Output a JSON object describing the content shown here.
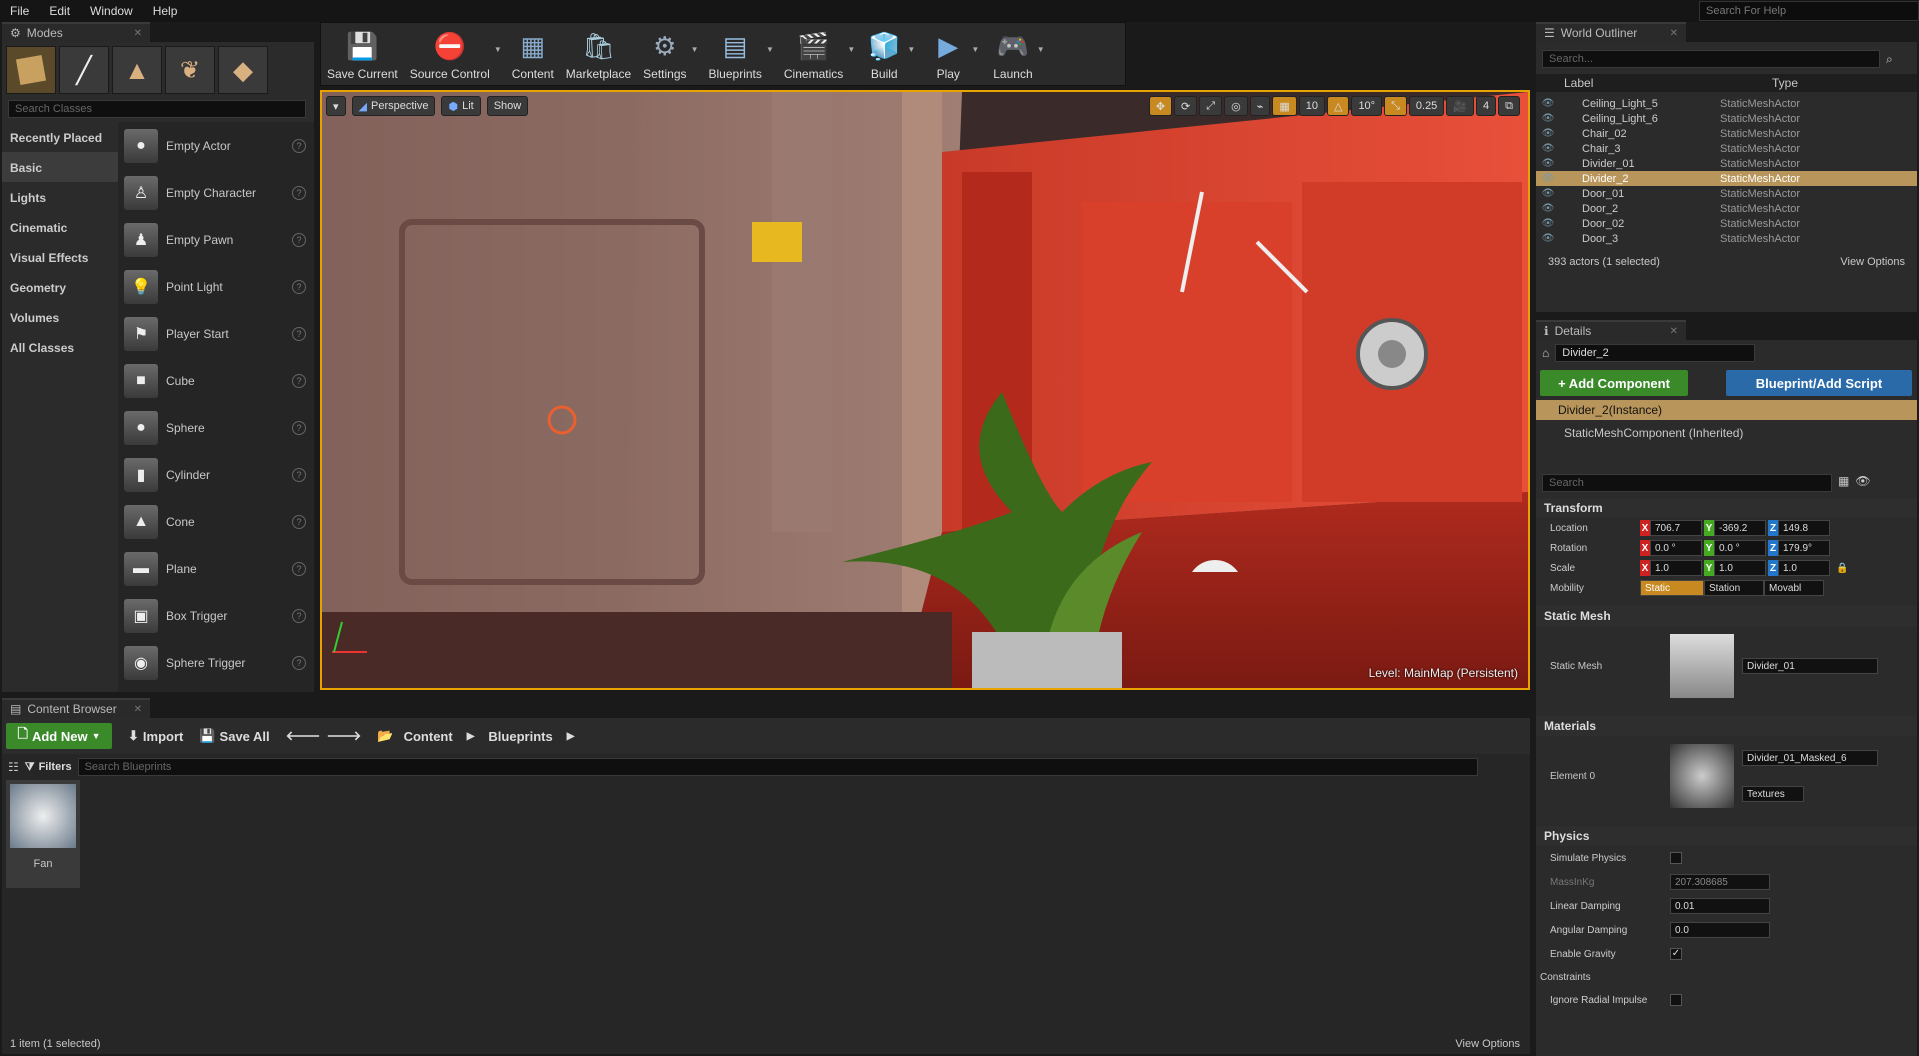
{
  "menu": [
    "File",
    "Edit",
    "Window",
    "Help"
  ],
  "help_search": "Search For Help",
  "modes": {
    "tab": "Modes",
    "search_placeholder": "Search Classes",
    "categories": [
      "Recently Placed",
      "Basic",
      "Lights",
      "Cinematic",
      "Visual Effects",
      "Geometry",
      "Volumes",
      "All Classes"
    ],
    "items": [
      "Empty Actor",
      "Empty Character",
      "Empty Pawn",
      "Point Light",
      "Player Start",
      "Cube",
      "Sphere",
      "Cylinder",
      "Cone",
      "Plane",
      "Box Trigger",
      "Sphere Trigger"
    ]
  },
  "toolbar": [
    "Save Current",
    "Source Control",
    "Content",
    "Marketplace",
    "Settings",
    "Blueprints",
    "Cinematics",
    "Build",
    "Play",
    "Launch"
  ],
  "viewport": {
    "perspective": "Perspective",
    "lit": "Lit",
    "show": "Show",
    "grid_snap": "10",
    "rot_snap": "10°",
    "scale_snap": "0.25",
    "cam_speed": "4",
    "level_label": "Level:",
    "level_name": "MainMap (Persistent)"
  },
  "outliner": {
    "tab": "World Outliner",
    "search": "Search...",
    "col_label": "Label",
    "col_type": "Type",
    "rows": [
      {
        "name": "Ceiling_Light_5",
        "type": "StaticMeshActor"
      },
      {
        "name": "Ceiling_Light_6",
        "type": "StaticMeshActor"
      },
      {
        "name": "Chair_02",
        "type": "StaticMeshActor"
      },
      {
        "name": "Chair_3",
        "type": "StaticMeshActor"
      },
      {
        "name": "Divider_01",
        "type": "StaticMeshActor"
      },
      {
        "name": "Divider_2",
        "type": "StaticMeshActor"
      },
      {
        "name": "Door_01",
        "type": "StaticMeshActor"
      },
      {
        "name": "Door_2",
        "type": "StaticMeshActor"
      },
      {
        "name": "Door_02",
        "type": "StaticMeshActor"
      },
      {
        "name": "Door_3",
        "type": "StaticMeshActor"
      }
    ],
    "status": "393 actors (1 selected)",
    "view_options": "View Options"
  },
  "details": {
    "tab": "Details",
    "name": "Divider_2",
    "add_component": "+ Add Component",
    "blueprint": "Blueprint/Add Script",
    "instance": "Divider_2(Instance)",
    "component": "StaticMeshComponent (Inherited)",
    "search": "Search",
    "transform": "Transform",
    "location": {
      "label": "Location",
      "x": "706.7",
      "y": "-369.2",
      "z": "149.8"
    },
    "rotation": {
      "label": "Rotation",
      "x": "0.0 °",
      "y": "0.0 °",
      "z": "179.9°"
    },
    "scale": {
      "label": "Scale",
      "x": "1.0",
      "y": "1.0",
      "z": "1.0"
    },
    "mobility": {
      "label": "Mobility",
      "static": "Static",
      "stationary": "Station",
      "movable": "Movabl"
    },
    "static_mesh_section": "Static Mesh",
    "static_mesh_label": "Static Mesh",
    "static_mesh_value": "Divider_01",
    "materials_section": "Materials",
    "element0": "Element 0",
    "material_value": "Divider_01_Masked_6",
    "textures": "Textures",
    "physics_section": "Physics",
    "simulate_physics": "Simulate Physics",
    "mass_label": "MassInKg",
    "mass_value": "207.308685",
    "linear_damping": "Linear Damping",
    "linear_damping_value": "0.01",
    "angular_damping": "Angular Damping",
    "angular_damping_value": "0.0",
    "enable_gravity": "Enable Gravity",
    "constraints": "Constraints",
    "ignore_radial": "Ignore Radial Impulse"
  },
  "content_browser": {
    "tab": "Content Browser",
    "add_new": "Add New",
    "import": "Import",
    "save_all": "Save All",
    "path": [
      "Content",
      "Blueprints"
    ],
    "filters": "Filters",
    "search": "Search Blueprints",
    "asset": "Fan",
    "status": "1 item (1 selected)",
    "view_options": "View Options"
  }
}
